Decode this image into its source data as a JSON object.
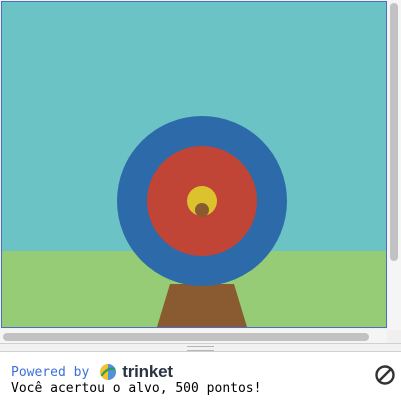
{
  "colors": {
    "sky": "#6cc3c6",
    "grass": "#97cc76",
    "post": "#8a5a30",
    "ring_outer": "#2d6aaa",
    "ring_middle": "#c04536",
    "bullseye": "#dcc32e",
    "hit_mark": "#8a5a30",
    "powered_by": "#3b6fd8"
  },
  "target": {
    "rings": [
      "blue",
      "red",
      "yellow"
    ],
    "hit": "center"
  },
  "footer": {
    "powered_by_label": "Powered by",
    "brand_name": "trinket",
    "brand_icon": "trinket-logo-icon"
  },
  "console": {
    "output_text": "Você acertou o alvo, 500 pontos!"
  },
  "controls": {
    "stop_icon": "stop-icon"
  }
}
